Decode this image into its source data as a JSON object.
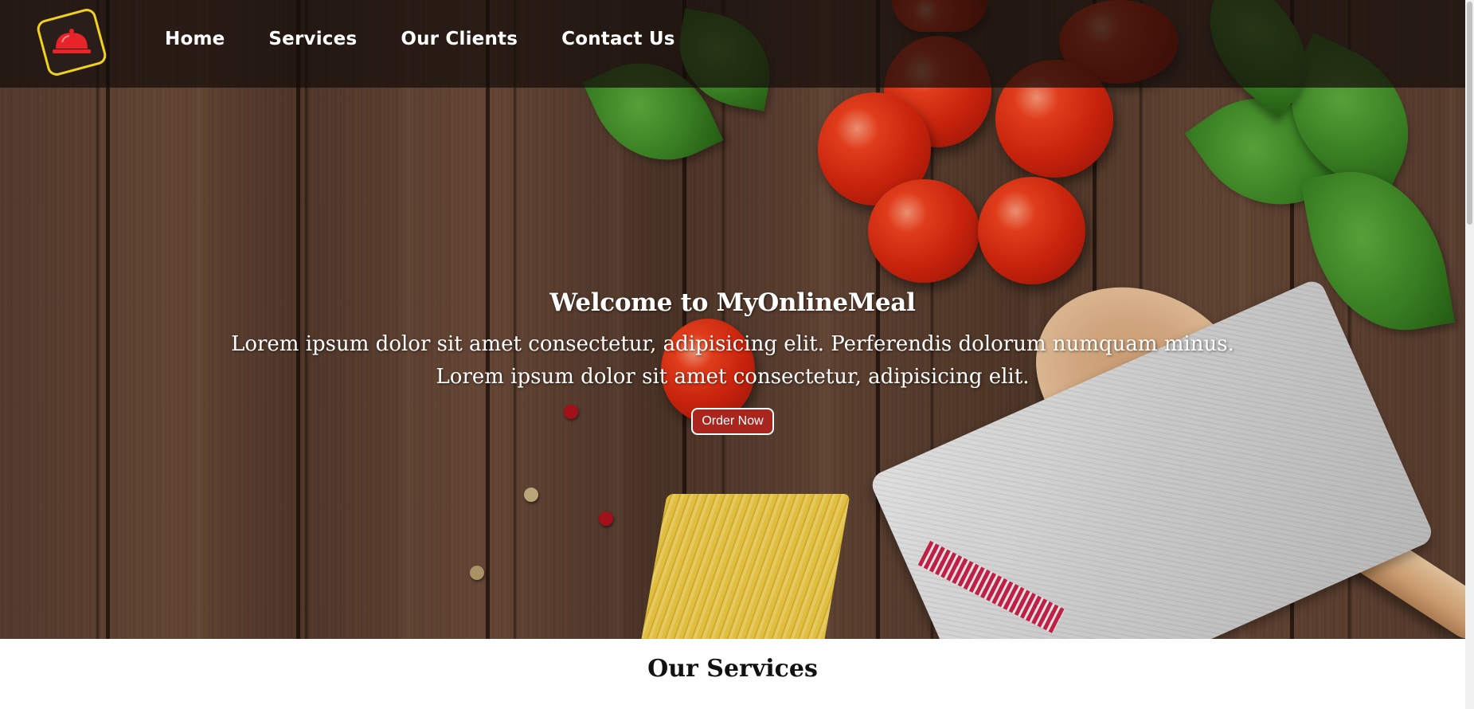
{
  "nav": {
    "logo_icon": "cloche-icon",
    "links": [
      {
        "label": "Home"
      },
      {
        "label": "Services"
      },
      {
        "label": "Our Clients"
      },
      {
        "label": "Contact Us"
      }
    ]
  },
  "hero": {
    "title": "Welcome to MyOnlineMeal",
    "text": "Lorem ipsum dolor sit amet consectetur, adipisicing elit. Perferendis dolorum numquam minus. Lorem ipsum dolor sit amet consectetur, adipisicing elit.",
    "button_label": "Order Now"
  },
  "services": {
    "title": "Our Services"
  },
  "colors": {
    "accent": "#a8261e",
    "logo_border": "#f2d21a"
  }
}
